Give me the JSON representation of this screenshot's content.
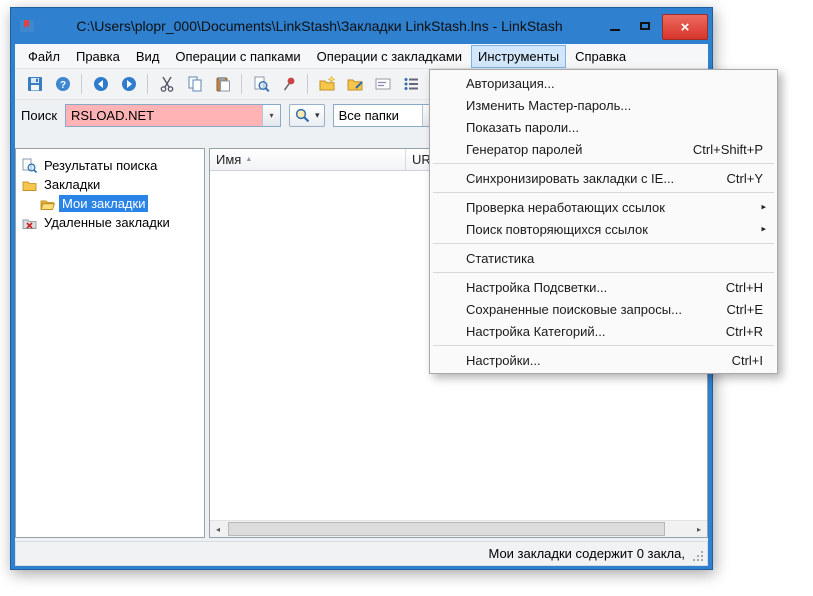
{
  "titlebar": {
    "title": "C:\\Users\\plopr_000\\Documents\\LinkStash\\Закладки LinkStash.lns - LinkStash"
  },
  "icons": {
    "caret_down": "▾",
    "submenu_arrow": "▸",
    "close": "×",
    "scroll_left": "◂",
    "scroll_right": "▸"
  },
  "menubar": {
    "items": [
      {
        "label": "Файл"
      },
      {
        "label": "Правка"
      },
      {
        "label": "Вид"
      },
      {
        "label": "Операции с папками"
      },
      {
        "label": "Операции с закладками"
      },
      {
        "label": "Инструменты"
      },
      {
        "label": "Справка"
      }
    ],
    "active_item": "Инструменты"
  },
  "toolbar": {
    "buttons": [
      {
        "icon": "save-icon"
      },
      {
        "icon": "help-icon"
      },
      {
        "icon": "back-icon"
      },
      {
        "icon": "forward-icon"
      },
      {
        "icon": "cut-icon"
      },
      {
        "icon": "copy-icon"
      },
      {
        "icon": "paste-icon"
      },
      {
        "icon": "find-icon"
      },
      {
        "icon": "pin-icon"
      },
      {
        "icon": "new-folder-icon"
      },
      {
        "icon": "folder-edit-icon"
      },
      {
        "icon": "rename-icon"
      },
      {
        "icon": "list-icon"
      },
      {
        "icon": "categories-icon"
      },
      {
        "icon": "globe-icon"
      },
      {
        "icon": "open-in-browser-icon"
      }
    ]
  },
  "search": {
    "label": "Поиск",
    "value": "RSLOAD.NET",
    "scope_value": "Все папки",
    "field_color": "#ffb3b5"
  },
  "tree": {
    "items": [
      {
        "label": "Результаты поиска",
        "icon": "search-results-icon",
        "selected": false
      },
      {
        "label": "Закладки",
        "icon": "folder-icon",
        "selected": false
      },
      {
        "label": "Мои закладки",
        "icon": "open-folder-icon",
        "selected": true
      },
      {
        "label": "Удаленные закладки",
        "icon": "deleted-folder-icon",
        "selected": false
      }
    ]
  },
  "list": {
    "columns": [
      {
        "label": "Имя",
        "sort_indicator": "▲"
      },
      {
        "label": "URL",
        "sort_indicator": ""
      }
    ],
    "rows": []
  },
  "statusbar": {
    "text": "Мои закладки содержит 0 закла,"
  },
  "tools_menu": {
    "items": [
      {
        "label": "Авторизация...",
        "shortcut": ""
      },
      {
        "label": "Изменить Мастер-пароль...",
        "shortcut": ""
      },
      {
        "label": "Показать пароли...",
        "shortcut": ""
      },
      {
        "label": "Генератор паролей",
        "shortcut": "Ctrl+Shift+P"
      },
      {
        "separator": true
      },
      {
        "label": "Синхронизировать закладки с IE...",
        "shortcut": "Ctrl+Y"
      },
      {
        "separator": true
      },
      {
        "label": "Проверка неработающих ссылок",
        "submenu": true
      },
      {
        "label": "Поиск повторяющихся ссылок",
        "submenu": true
      },
      {
        "separator": true
      },
      {
        "label": "Статистика",
        "shortcut": ""
      },
      {
        "separator": true
      },
      {
        "label": "Настройка Подсветки...",
        "shortcut": "Ctrl+H"
      },
      {
        "label": "Сохраненные поисковые запросы...",
        "shortcut": "Ctrl+E"
      },
      {
        "label": "Настройка Категорий...",
        "shortcut": "Ctrl+R"
      },
      {
        "separator": true
      },
      {
        "label": "Настройки...",
        "shortcut": "Ctrl+I"
      }
    ]
  }
}
